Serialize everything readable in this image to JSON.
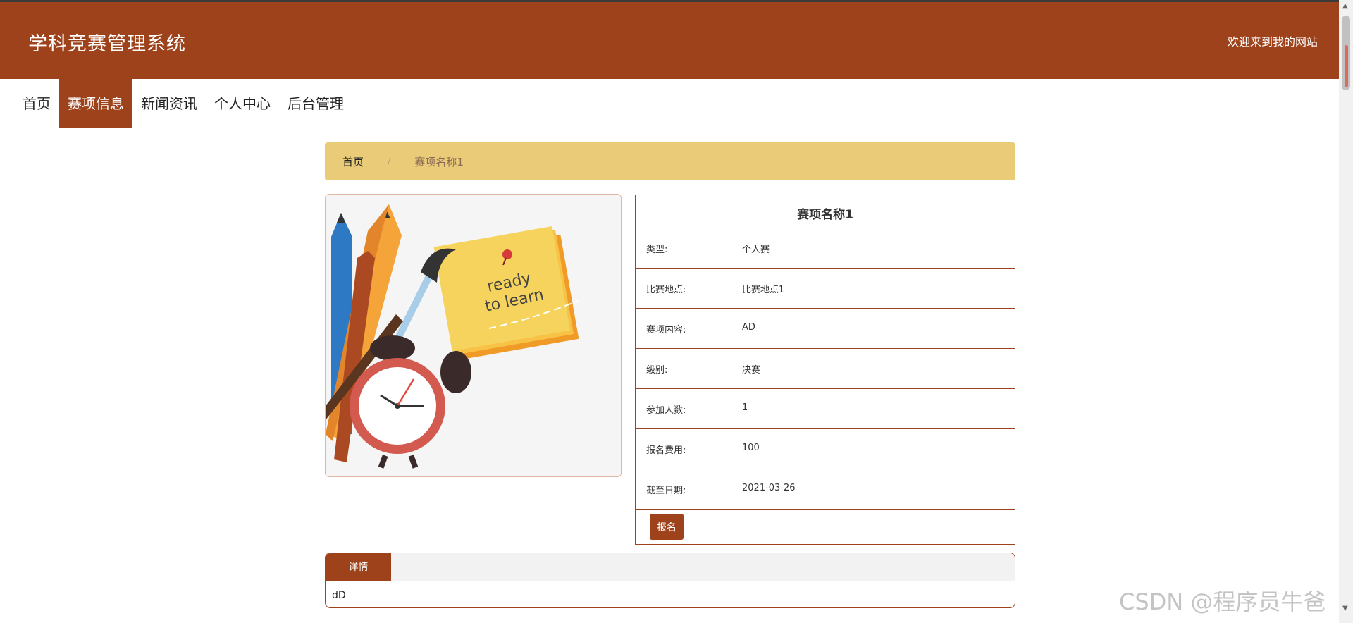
{
  "header": {
    "site_title": "学科竞赛管理系统",
    "welcome": "欢迎来到我的网站"
  },
  "nav": {
    "items": [
      {
        "label": "首页"
      },
      {
        "label": "赛项信息",
        "active": true
      },
      {
        "label": "新闻资讯"
      },
      {
        "label": "个人中心"
      },
      {
        "label": "后台管理"
      }
    ]
  },
  "breadcrumb": {
    "home": "首页",
    "separator": "/",
    "current": "赛项名称1"
  },
  "image": {
    "illustration": "pencils-brush-clock-sticky-note",
    "note_line1": "ready",
    "note_line2": "to learn"
  },
  "detail": {
    "title": "赛项名称1",
    "rows": [
      {
        "label": "类型:",
        "value": "个人赛"
      },
      {
        "label": "比赛地点:",
        "value": "比赛地点1"
      },
      {
        "label": "赛项内容:",
        "value": "AD"
      },
      {
        "label": "级别:",
        "value": "决赛"
      },
      {
        "label": "参加人数:",
        "value": "1"
      },
      {
        "label": "报名费用:",
        "value": "100"
      },
      {
        "label": "截至日期:",
        "value": "2021-03-26"
      }
    ],
    "signup_label": "报名"
  },
  "details_panel": {
    "tab_label": "详情",
    "content": "dD"
  },
  "watermark": "CSDN @程序员牛爸",
  "colors": {
    "brand": "#9e421b",
    "breadcrumb_bg": "#e9cb78"
  }
}
